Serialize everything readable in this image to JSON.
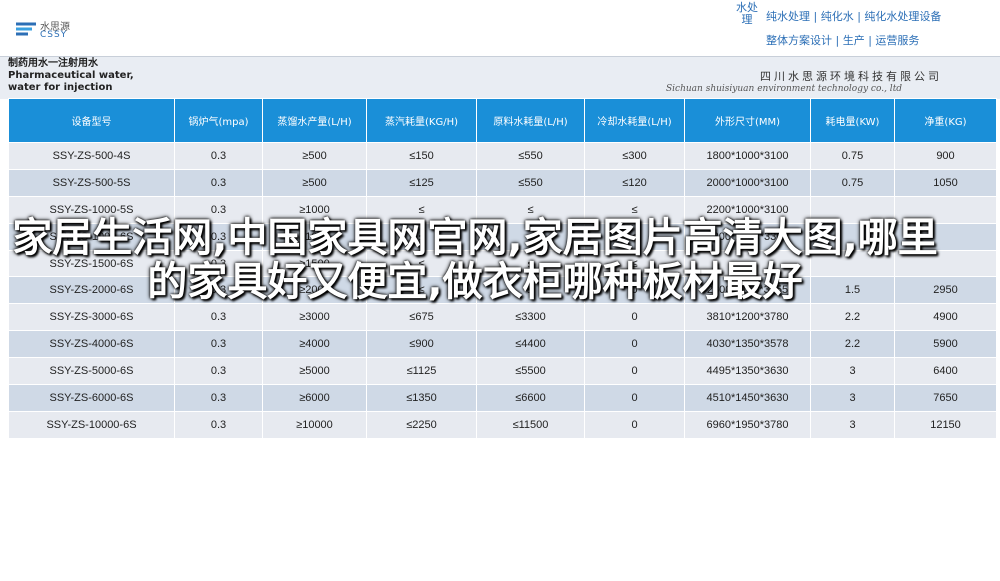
{
  "brand": {
    "name_cn": "水思源",
    "name_en": "CSSY"
  },
  "header": {
    "vertical_text": "水处理",
    "slogan_line1": "纯水处理 | 纯化水 | 纯化水处理设备",
    "slogan_line2": "整体方案设计 | 生产 | 运营服务"
  },
  "product_title": "制药用水一注射用水 Pharmaceutical water, water for injection",
  "company": {
    "name_cn": "四川水思源环境科技有限公司",
    "name_en": "Sichuan shuisiyuan environment technology co., ltd"
  },
  "table": {
    "headers": [
      "设备型号",
      "锅炉气(mpa)",
      "蒸馏水产量(L/H)",
      "蒸汽耗量(KG/H)",
      "原料水耗量(L/H)",
      "冷却水耗量(L/H)",
      "外形尺寸(MM)",
      "耗电量(KW)",
      "净重(KG)"
    ],
    "rows": [
      [
        "SSY-ZS-500-4S",
        "0.3",
        "≥500",
        "≤150",
        "≤550",
        "≤300",
        "1800*1000*3100",
        "0.75",
        "900"
      ],
      [
        "SSY-ZS-500-5S",
        "0.3",
        "≥500",
        "≤125",
        "≤550",
        "≤120",
        "2000*1000*3100",
        "0.75",
        "1050"
      ],
      [
        "SSY-ZS-1000-5S",
        "0.3",
        "≥1000",
        "≤",
        "≤",
        "≤",
        "2200*1000*3100",
        "",
        ""
      ],
      [
        "SSY-ZS-1000-6S",
        "0.3",
        "≥1000",
        "≤",
        "≤",
        "≤",
        "2200*1000*3300",
        "",
        ""
      ],
      [
        "SSY-ZS-1500-6S",
        "0.3",
        "≥1500",
        "≤",
        "≤",
        "≤",
        "",
        "",
        ""
      ],
      [
        "SSY-ZS-2000-6S",
        "0.3",
        "≥2000",
        "≤",
        "≤",
        "0",
        "2800*1150*3355",
        "1.5",
        "2950"
      ],
      [
        "SSY-ZS-3000-6S",
        "0.3",
        "≥3000",
        "≤675",
        "≤3300",
        "0",
        "3810*1200*3780",
        "2.2",
        "4900"
      ],
      [
        "SSY-ZS-4000-6S",
        "0.3",
        "≥4000",
        "≤900",
        "≤4400",
        "0",
        "4030*1350*3578",
        "2.2",
        "5900"
      ],
      [
        "SSY-ZS-5000-6S",
        "0.3",
        "≥5000",
        "≤1125",
        "≤5500",
        "0",
        "4495*1350*3630",
        "3",
        "6400"
      ],
      [
        "SSY-ZS-6000-6S",
        "0.3",
        "≥6000",
        "≤1350",
        "≤6600",
        "0",
        "4510*1450*3630",
        "3",
        "7650"
      ],
      [
        "SSY-ZS-10000-6S",
        "0.3",
        "≥10000",
        "≤2250",
        "≤11500",
        "0",
        "6960*1950*3780",
        "3",
        "12150"
      ]
    ]
  },
  "overlay_text": "家居生活网,中国家具网官网,家居图片高清大图,哪里的家具好又便宜,做衣柜哪种板材最好"
}
